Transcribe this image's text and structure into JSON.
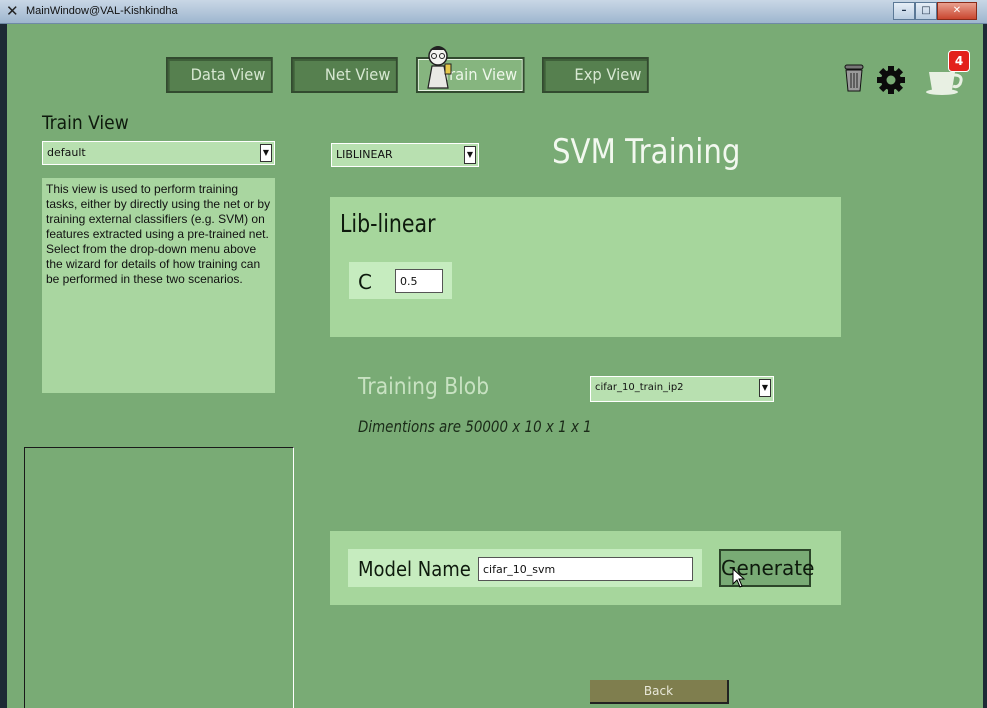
{
  "window": {
    "title": "MainWindow@VAL-Kishkindha",
    "controls": {
      "minimize": "–",
      "maximize": "□",
      "close": "✕"
    }
  },
  "nav": {
    "tabs": [
      {
        "label": "Data View",
        "active": false
      },
      {
        "label": "Net View",
        "active": false
      },
      {
        "label": "Train View",
        "active": true
      },
      {
        "label": "Exp View",
        "active": false
      }
    ]
  },
  "toolbar": {
    "icons": [
      "trash-icon",
      "gear-icon",
      "coffee-cup-icon"
    ],
    "notification_count": "4"
  },
  "left": {
    "title": "Train View",
    "view_select": "default",
    "description": "This view is used to perform training tasks, either by directly using the net or by training external classifiers (e.g. SVM) on features extracted using a pre-trained net. Select from the drop-down menu above the wizard for details of how training can be performed in these two scenarios."
  },
  "main": {
    "solver_select": "LIBLINEAR",
    "heading": "SVM Training",
    "lib_title": "Lib-linear",
    "c_label": "C",
    "c_value": "0.5",
    "blob_label": "Training Blob",
    "blob_select": "cifar_10_train_ip2",
    "dimensions": "Dimentions are 50000 x 10 x 1 x 1",
    "model_label": "Model Name",
    "model_value": "cifar_10_svm",
    "generate_label": "Generate",
    "back_label": "Back"
  },
  "colors": {
    "background": "#79ab75",
    "panel": "#a6d69c",
    "badge": "#e3201b",
    "back_button": "#7f7e4e"
  }
}
